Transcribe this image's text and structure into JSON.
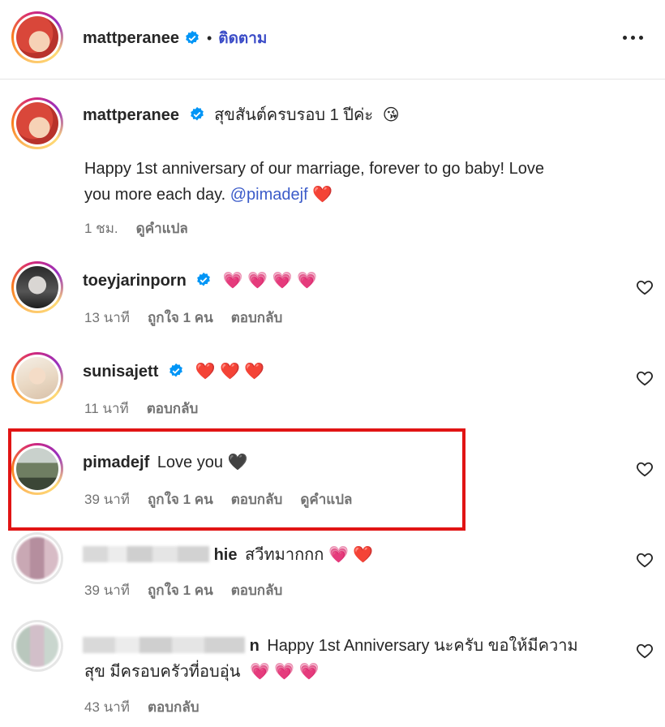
{
  "header": {
    "username": "mattperanee",
    "separator": "•",
    "follow_label": "ติดตาม"
  },
  "post": {
    "username": "mattperanee",
    "caption_first": "สุขสันต์ครบรอบ 1 ปีค่ะ",
    "caption_first_emoji": "😘",
    "caption_line2": "Happy 1st anniversary of our marriage, forever to go baby! Love",
    "caption_line3": "you more each day.",
    "mention": "@pimadejf",
    "end_emoji": "❤️",
    "time": "1 ชม.",
    "translate": "ดูคำแปล"
  },
  "comments": [
    {
      "username": "toeyjarinporn",
      "text": "💗 💗 💗 💗",
      "time": "13 นาที",
      "likes": "ถูกใจ 1 คน",
      "reply": "ตอบกลับ"
    },
    {
      "username": "sunisajett",
      "text": "❤️ ❤️ ❤️",
      "time": "11 นาที",
      "reply": "ตอบกลับ"
    },
    {
      "username": "pimadejf",
      "text": "Love you",
      "emoji": "🖤",
      "time": "39 นาที",
      "likes": "ถูกใจ 1 คน",
      "reply": "ตอบกลับ",
      "translate": "ดูคำแปล"
    },
    {
      "username_visible": "hie",
      "text": "สวีทมากกก",
      "emoji": "💗 ❤️",
      "time": "39 นาที",
      "likes": "ถูกใจ 1 คน",
      "reply": "ตอบกลับ"
    },
    {
      "username_visible": "n",
      "text1": "Happy 1st Anniversary นะครับ ขอให้มีความ",
      "text2": "สุข มีครอบครัวที่อบอุ่น",
      "emoji": "💗 💗 💗",
      "time": "43 นาที",
      "reply": "ตอบกลับ"
    }
  ],
  "colors": {
    "verified": "#0095f6",
    "link": "#3b4cc7",
    "highlight": "#e11414"
  }
}
